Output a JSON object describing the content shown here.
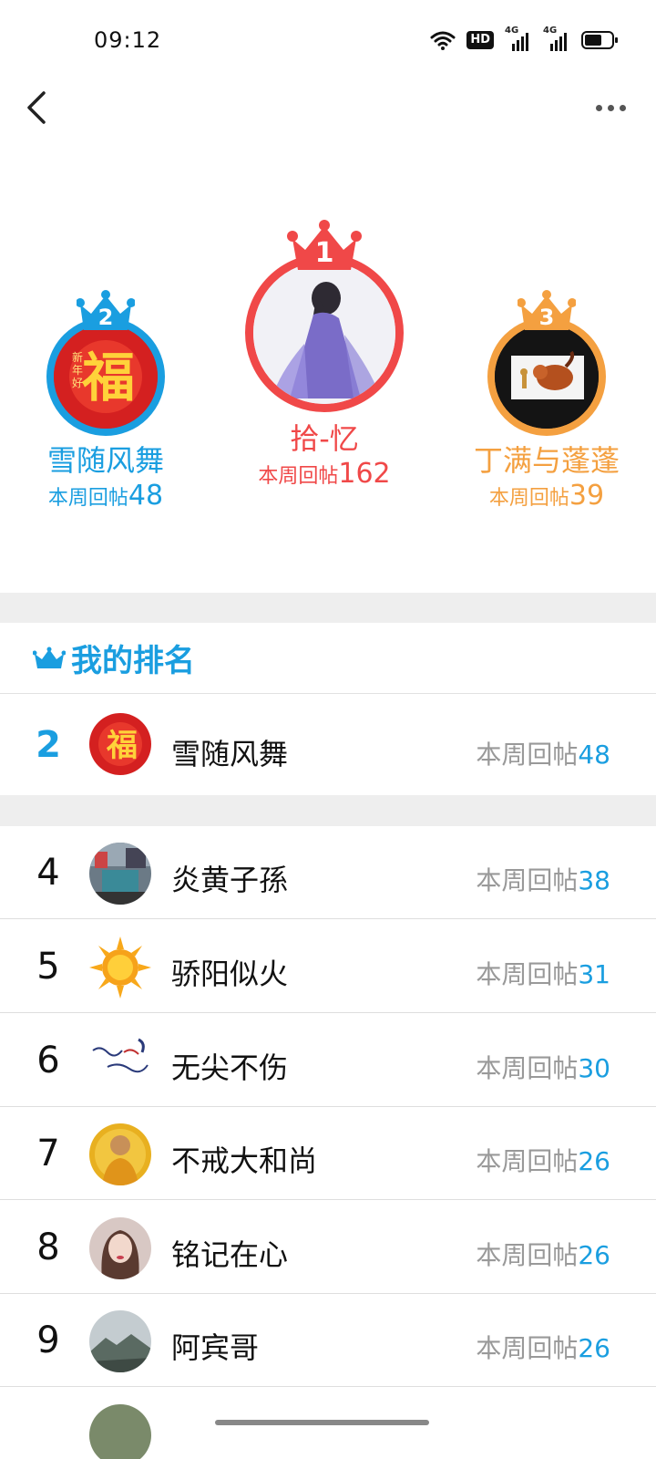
{
  "status_bar": {
    "time": "09:12",
    "hd_label": "HD",
    "net1": "4G",
    "net2": "4G"
  },
  "colors": {
    "accent": "#1a9ee0",
    "first": "#f04848",
    "second": "#1a9ee0",
    "third": "#f4a040",
    "stat_gray": "#999999"
  },
  "podium": {
    "first": {
      "rank": "1",
      "name": "拾-忆",
      "stat_label": "本周回帖",
      "count": "162"
    },
    "second": {
      "rank": "2",
      "name": "雪随风舞",
      "stat_label": "本周回帖",
      "count": "48"
    },
    "third": {
      "rank": "3",
      "name": "丁满与蓬蓬",
      "stat_label": "本周回帖",
      "count": "39"
    }
  },
  "my_rank": {
    "header": "我的排名",
    "rank": "2",
    "name": "雪随风舞",
    "stat_label": "本周回帖",
    "count": "48"
  },
  "list": [
    {
      "rank": "4",
      "name": "炎黄子孫",
      "stat_label": "本周回帖",
      "count": "38"
    },
    {
      "rank": "5",
      "name": "骄阳似火",
      "stat_label": "本周回帖",
      "count": "31"
    },
    {
      "rank": "6",
      "name": "无尖不伤",
      "stat_label": "本周回帖",
      "count": "30"
    },
    {
      "rank": "7",
      "name": "不戒大和尚",
      "stat_label": "本周回帖",
      "count": "26"
    },
    {
      "rank": "8",
      "name": "铭记在心",
      "stat_label": "本周回帖",
      "count": "26"
    },
    {
      "rank": "9",
      "name": "阿宾哥",
      "stat_label": "本周回帖",
      "count": "26"
    }
  ],
  "avatar_icons": {
    "fu": "fu-new-year-avatar",
    "lady": "woman-in-purple-avatar",
    "lion_king": "timon-pumbaa-avatar",
    "street": "street-photo-avatar",
    "sun": "sun-avatar",
    "calligraphy": "calligraphy-avatar",
    "monk": "monk-avatar",
    "woman": "woman-portrait-avatar",
    "mountain": "mountain-landscape-avatar"
  }
}
